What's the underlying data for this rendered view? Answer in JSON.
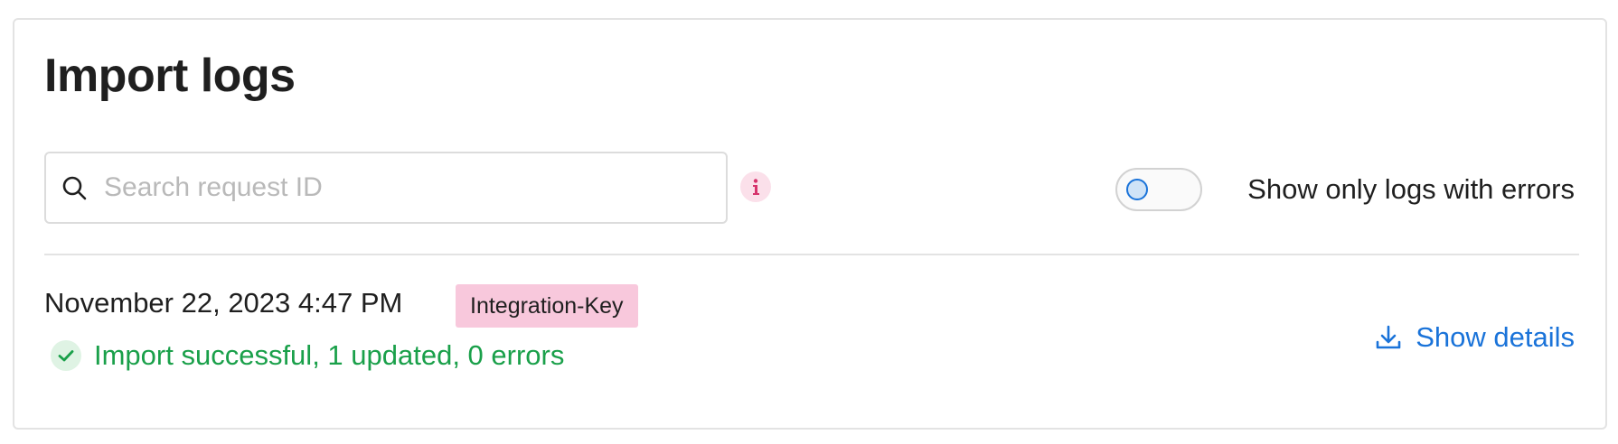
{
  "header": {
    "title": "Import logs"
  },
  "filters": {
    "search": {
      "placeholder": "Search request ID",
      "value": "",
      "icon": "search-icon"
    },
    "info_icon": "info-icon",
    "errors_toggle": {
      "label": "Show only logs with errors",
      "checked": false
    }
  },
  "logs": [
    {
      "timestamp": "November 22, 2023 4:47 PM",
      "badge": "Integration-Key",
      "status_icon": "check-circle-icon",
      "status_text": "Import successful, 1 updated, 0 errors",
      "details_icon": "download-icon",
      "details_label": "Show details"
    }
  ],
  "colors": {
    "accent": "#1a73d9",
    "success": "#1aa04a",
    "badge_bg": "#f8c8dc",
    "info_icon_bg": "#fbe0ea",
    "info_icon_fg": "#d6336c"
  }
}
